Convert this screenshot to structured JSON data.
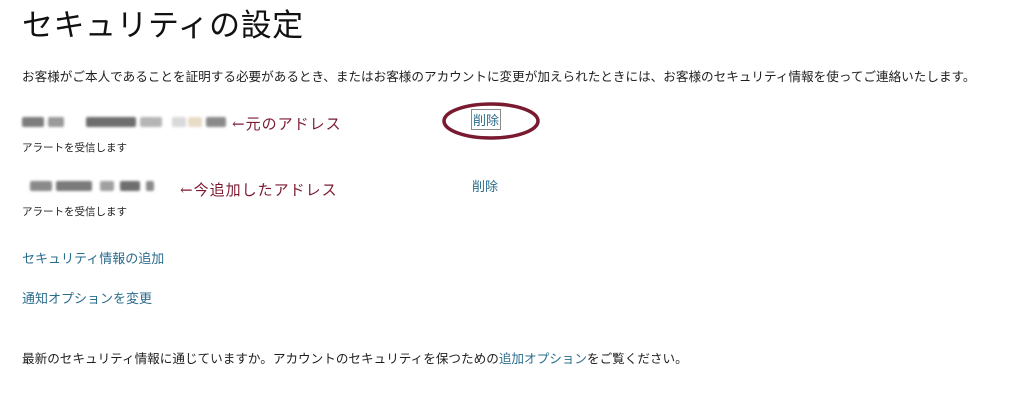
{
  "page": {
    "title": "セキュリティの設定",
    "intro": "お客様がご本人であることを証明する必要があるとき、またはお客様のアカウントに変更が加えられたときには、お客様のセキュリティ情報を使ってご連絡いたします。"
  },
  "entries": [
    {
      "status": "アラートを受信します",
      "delete_label": "削除",
      "annotation": "←元のアドレス"
    },
    {
      "status": "アラートを受信します",
      "delete_label": "削除",
      "annotation": "←今追加したアドレス"
    }
  ],
  "actions": {
    "add_security_info": "セキュリティ情報の追加",
    "change_notification_options": "通知オプションを変更"
  },
  "footer": {
    "text_before": "最新のセキュリティ情報に通じていますか。アカウントのセキュリティを保つための",
    "link": "追加オプション",
    "text_after": "をご覧ください。"
  },
  "colors": {
    "link": "#2a6c8c",
    "annotation": "#7a1a30"
  }
}
